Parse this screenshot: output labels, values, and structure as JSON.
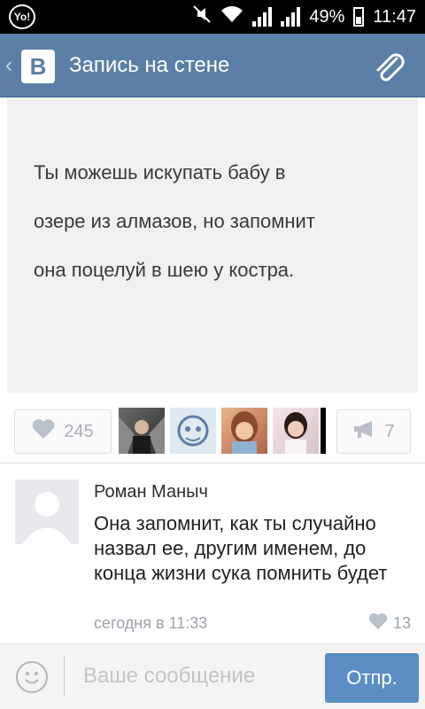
{
  "status_bar": {
    "logo_text": "Yo!",
    "battery": "49%",
    "time": "11:47"
  },
  "header": {
    "back_icon": "chevron-left-icon",
    "logo_text": "В",
    "title": "Запись на стене",
    "attach_icon": "paperclip-icon"
  },
  "post": {
    "text_lines": [
      "Ты можешь искупать бабу в",
      "озере из алмазов, но запомнит",
      "она поцелуй в шею у костра."
    ]
  },
  "reactions": {
    "likes_count": "245",
    "shares_count": "7"
  },
  "comment": {
    "author": "Роман Маныч",
    "text": "Она запомнит, как ты случайно назвал ее, другим именем, до конца жизни сука помнить будет",
    "time": "сегодня в 11:33",
    "likes": "13"
  },
  "composer": {
    "placeholder": "Ваше сообщение",
    "send_label": "Отпр."
  },
  "colors": {
    "header_bg": "#5b7fa6",
    "send_bg": "#5b8ec4"
  }
}
